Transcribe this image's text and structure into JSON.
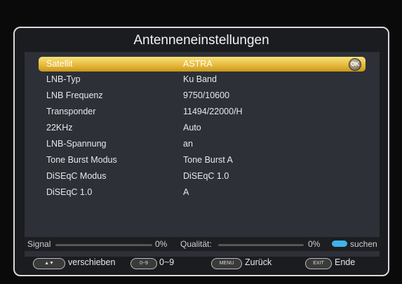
{
  "title": "Antenneneinstellungen",
  "rows": [
    {
      "label": "Satellit",
      "value": "ASTRA"
    },
    {
      "label": "LNB-Typ",
      "value": "Ku Band"
    },
    {
      "label": "LNB Frequenz",
      "value": "9750/10600"
    },
    {
      "label": "Transponder",
      "value": "11494/22000/H"
    },
    {
      "label": "22KHz",
      "value": "Auto"
    },
    {
      "label": "LNB-Spannung",
      "value": "an"
    },
    {
      "label": "Tone Burst Modus",
      "value": "Tone Burst A"
    },
    {
      "label": "DiSEqC Modus",
      "value": "DiSEqC 1.0"
    },
    {
      "label": "DiSEqC 1.0",
      "value": "A"
    }
  ],
  "ok_icon": "OK",
  "status": {
    "signal_label": "Signal",
    "signal_value": "0%",
    "quality_label": "Qualität:",
    "quality_value": "0%",
    "search_label": "suchen"
  },
  "footer": {
    "move_key": "▲▼",
    "move_label": "verschieben",
    "num_key": "0~9",
    "num_label": "0~9",
    "menu_key": "MENU",
    "menu_label": "Zurück",
    "exit_key": "EXIT",
    "exit_label": "Ende"
  },
  "colors": {
    "highlight": "#e7bb3c",
    "search_button": "#3fb3e8"
  }
}
